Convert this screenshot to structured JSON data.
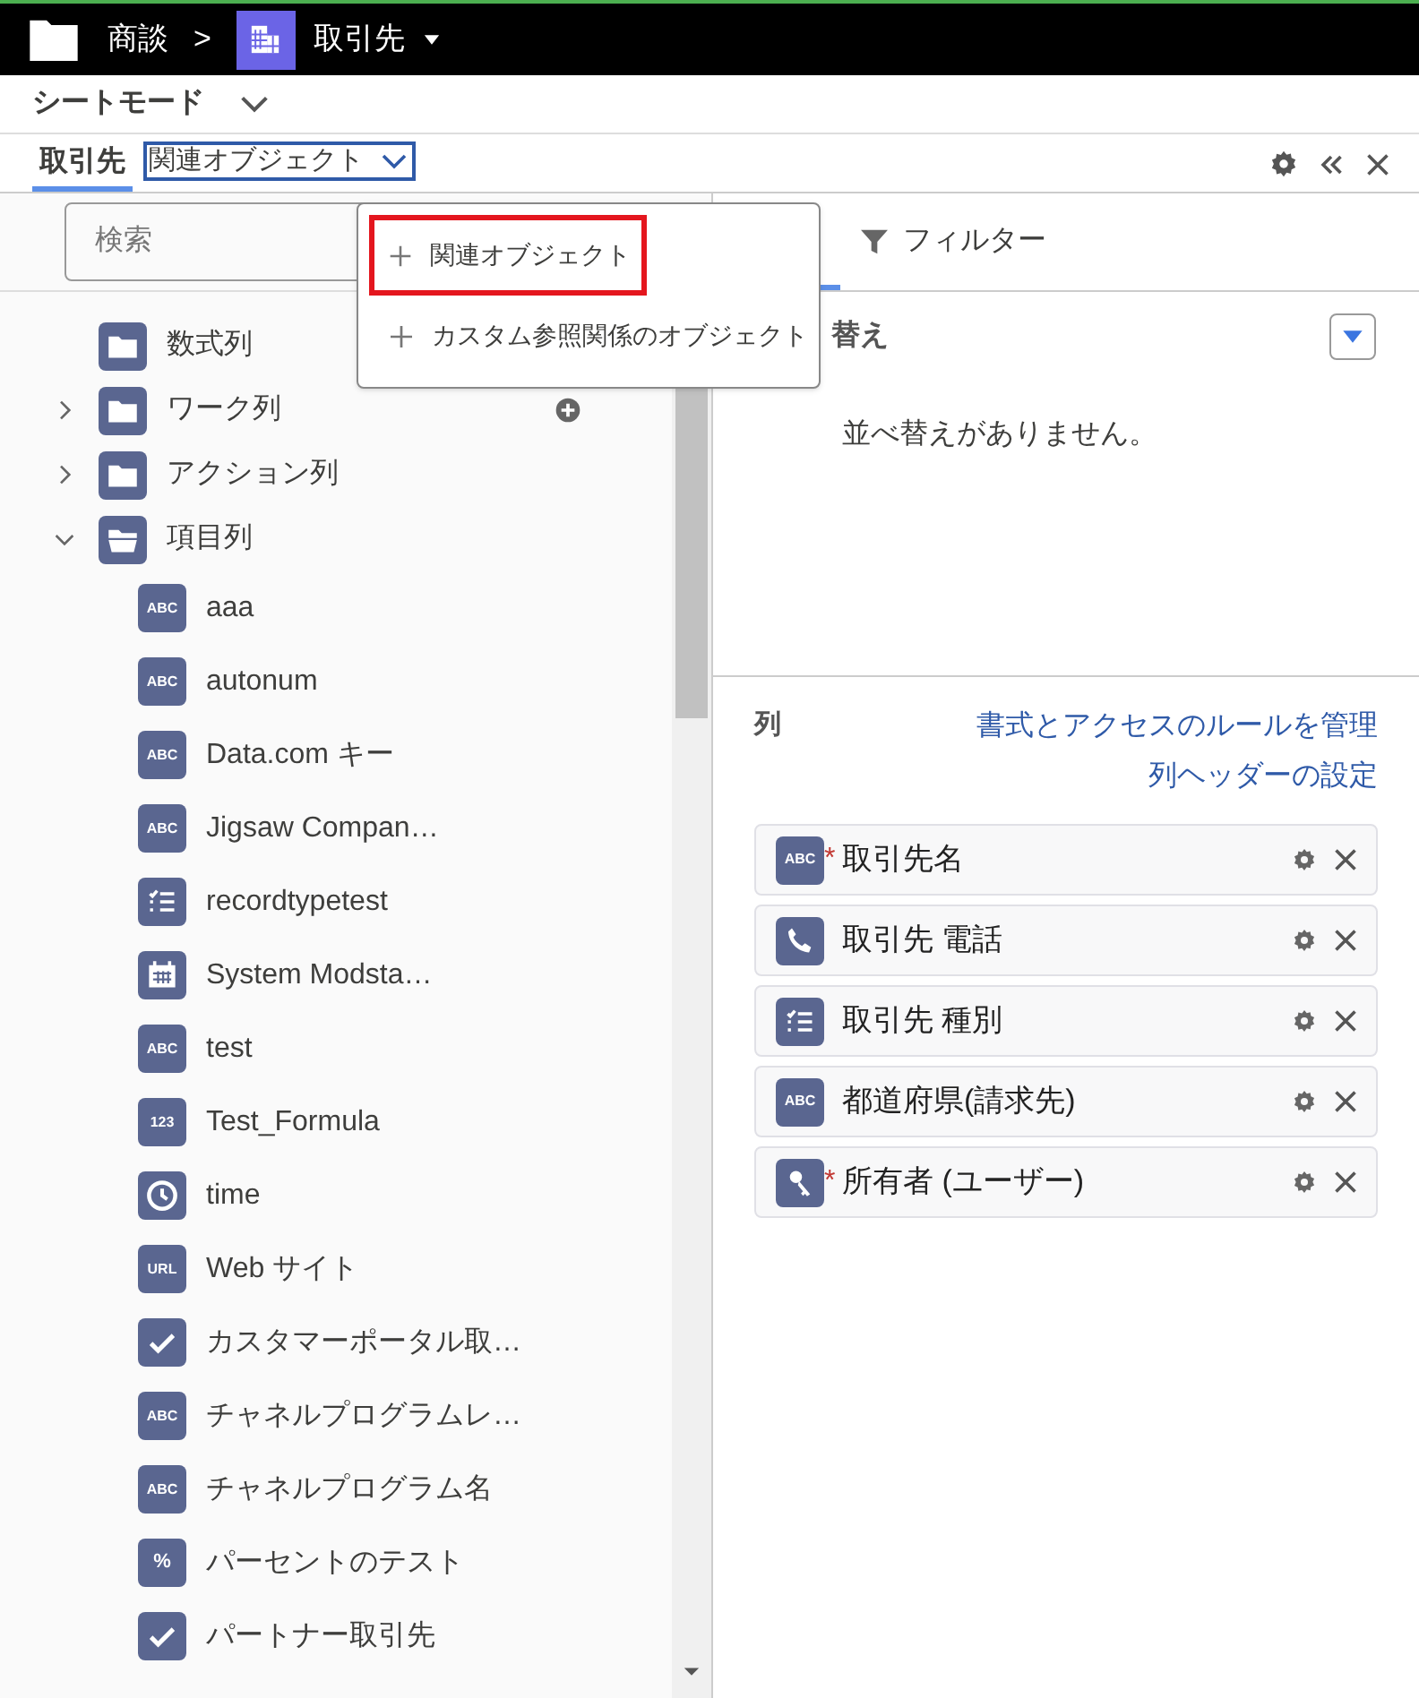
{
  "breadcrumb": {
    "parent": "商談",
    "separator": ">",
    "current": "取引先"
  },
  "mode": {
    "label": "シートモード"
  },
  "tabs": [
    {
      "label": "取引先",
      "selected": true,
      "kind": "tab"
    },
    {
      "label": "関連オブジェクト",
      "selected": false,
      "kind": "dropdown"
    }
  ],
  "search": {
    "placeholder": "検索"
  },
  "tree": [
    {
      "label": "数式列",
      "kind": "folder",
      "expandable": false
    },
    {
      "label": "ワーク列",
      "kind": "folder",
      "expandable": true,
      "expanded": false,
      "add_button": true
    },
    {
      "label": "アクション列",
      "kind": "folder",
      "expandable": true,
      "expanded": false
    },
    {
      "label": "項目列",
      "kind": "folder",
      "expandable": true,
      "expanded": true,
      "children": [
        {
          "label": "aaa",
          "kind": "text",
          "icon_label": "ABC"
        },
        {
          "label": "autonum",
          "kind": "text",
          "icon_label": "ABC"
        },
        {
          "label": "Data.com キー",
          "kind": "text",
          "icon_label": "ABC"
        },
        {
          "label": "Jigsaw Compan…",
          "kind": "text",
          "icon_label": "ABC"
        },
        {
          "label": "recordtypetest",
          "kind": "picklist"
        },
        {
          "label": "System Modsta…",
          "kind": "date"
        },
        {
          "label": "test",
          "kind": "text",
          "icon_label": "ABC"
        },
        {
          "label": "Test_Formula",
          "kind": "text",
          "icon_label": "123"
        },
        {
          "label": "time",
          "kind": "time"
        },
        {
          "label": "Web サイト",
          "kind": "text",
          "icon_label": "URL"
        },
        {
          "label": "カスタマーポータル取…",
          "kind": "checkbox"
        },
        {
          "label": "チャネルプログラムレ…",
          "kind": "text",
          "icon_label": "ABC"
        },
        {
          "label": "チャネルプログラム名",
          "kind": "text",
          "icon_label": "ABC"
        },
        {
          "label": "パーセントのテスト",
          "kind": "text",
          "icon_label": "%"
        },
        {
          "label": "パートナー取引先",
          "kind": "checkbox"
        }
      ]
    }
  ],
  "menu": [
    {
      "label": "関連オブジェクト",
      "annotated": true
    },
    {
      "label": "カスタム参照関係のオブジェクト",
      "annotated": false
    }
  ],
  "right_tabs": [
    {
      "label": "フィルター",
      "selected": false
    }
  ],
  "sort": {
    "heading": "替え",
    "empty": "並べ替えがありません。"
  },
  "columns": {
    "heading": "列",
    "links": [
      "書式とアクセスのルールを管理",
      "列ヘッダーの設定"
    ],
    "items": [
      {
        "label": "取引先名",
        "kind": "text",
        "icon_label": "ABC",
        "required_mark": "*"
      },
      {
        "label": "取引先 電話",
        "kind": "phone"
      },
      {
        "label": "取引先 種別",
        "kind": "picklist"
      },
      {
        "label": "都道府県(請求先)",
        "kind": "text",
        "icon_label": "ABC"
      },
      {
        "label": "所有者 (ユーザー)",
        "kind": "lookup",
        "required_mark": "*"
      }
    ]
  }
}
